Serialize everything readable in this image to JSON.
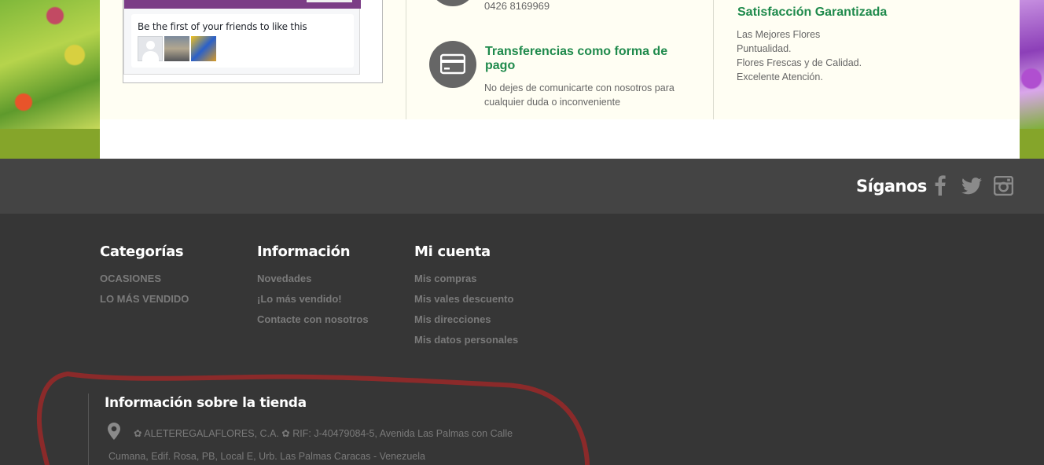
{
  "facebook_widget": {
    "like_prompt": "Be the first of your friends to like this",
    "friend_avatars": [
      "default-avatar",
      "friend-photo",
      "friend-photo"
    ]
  },
  "contact": {
    "phone": "0426 8169969",
    "transfer_title": "Transferencias como forma de pago",
    "transfer_description": "No dejes de comunicarte con nosotros para cualquier duda o inconveniente",
    "transfer_icon": "credit-card-icon",
    "phone_icon": "phone-icon"
  },
  "satisfaction": {
    "title": "Satisfacción Garantizada",
    "items": [
      "Las Mejores Flores",
      "Puntualidad.",
      "Flores Frescas y de Calidad.",
      "Excelente Atención."
    ]
  },
  "social": {
    "label": "Síganos",
    "icons": [
      "facebook-icon",
      "twitter-icon",
      "instagram-icon"
    ]
  },
  "footer": {
    "columns": [
      {
        "title": "Categorías",
        "links": [
          "OCASIONES",
          "LO MÁS VENDIDO"
        ]
      },
      {
        "title": "Información",
        "links": [
          "Novedades",
          "¡Lo más vendido!",
          "Contacte con nosotros"
        ]
      },
      {
        "title": "Mi cuenta",
        "links": [
          "Mis compras",
          "Mis vales descuento",
          "Mis direcciones",
          "Mis datos personales"
        ]
      }
    ],
    "store_info": {
      "title": "Información sobre la tienda",
      "address_line1": "✿ ALETEREGALAFLORES, C.A. ✿ RIF: J-40479084-5, Avenida Las Palmas con Calle",
      "address_line2": "Cumana, Edif. Rosa, PB, Local E, Urb. Las Palmas Caracas - Venezuela"
    }
  },
  "colors": {
    "accent_green": "#1f8a4c",
    "footer_dark": "#363636",
    "social_bar": "#444444",
    "annotation_red": "#8b2a2a"
  }
}
